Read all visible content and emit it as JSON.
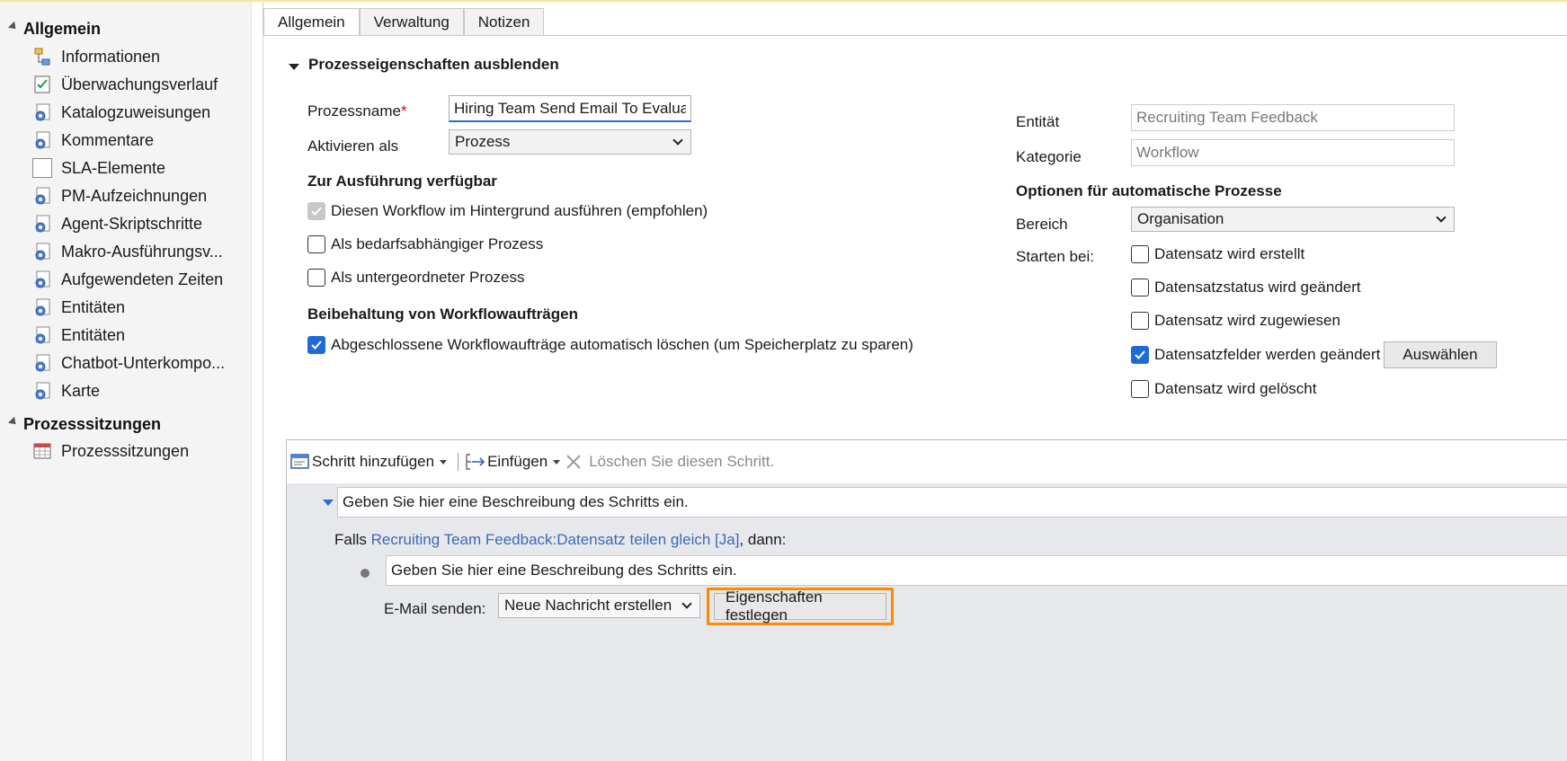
{
  "sidebar": {
    "section1": "Allgemein",
    "items": [
      {
        "label": "Informationen",
        "icon": "hierarchy-icon"
      },
      {
        "label": "Überwachungsverlauf",
        "icon": "checklist-icon"
      },
      {
        "label": "Katalogzuweisungen",
        "icon": "gear-doc-icon"
      },
      {
        "label": "Kommentare",
        "icon": "gear-doc-icon"
      },
      {
        "label": "SLA-Elemente",
        "icon": "blank-box-icon"
      },
      {
        "label": "PM-Aufzeichnungen",
        "icon": "gear-doc-icon"
      },
      {
        "label": "Agent-Skriptschritte",
        "icon": "gear-doc-icon"
      },
      {
        "label": "Makro-Ausführungsv...",
        "icon": "gear-doc-icon"
      },
      {
        "label": "Aufgewendeten Zeiten",
        "icon": "gear-doc-icon"
      },
      {
        "label": "Entitäten",
        "icon": "gear-doc-icon"
      },
      {
        "label": "Entitäten",
        "icon": "gear-doc-icon"
      },
      {
        "label": "Chatbot-Unterkompo...",
        "icon": "gear-doc-icon"
      },
      {
        "label": "Karte",
        "icon": "gear-doc-icon"
      }
    ],
    "section2": "Prozesssitzungen",
    "items2": [
      {
        "label": "Prozesssitzungen",
        "icon": "calendar-grid-icon"
      }
    ]
  },
  "tabs": [
    "Allgemein",
    "Verwaltung",
    "Notizen"
  ],
  "props": {
    "collapse_label": "Prozesseigenschaften ausblenden",
    "name_label": "Prozessname",
    "required_mark": "*",
    "name_value": "Hiring Team Send Email To Evaluate App",
    "activate_label": "Aktivieren als",
    "activate_value": "Prozess",
    "available_head": "Zur Ausführung verfügbar",
    "cb_background": "Diesen Workflow im Hintergrund ausführen (empfohlen)",
    "cb_ondemand": "Als bedarfsabhängiger Prozess",
    "cb_child": "Als untergeordneter Prozess",
    "retention_head": "Beibehaltung von Workflowaufträgen",
    "cb_delete": "Abgeschlossene Workflowaufträge automatisch löschen (um Speicherplatz zu sparen)",
    "entity_label": "Entität",
    "entity_value": "Recruiting Team Feedback",
    "category_label": "Kategorie",
    "category_value": "Workflow",
    "auto_head": "Optionen für automatische Prozesse",
    "scope_label": "Bereich",
    "scope_value": "Organisation",
    "start_label": "Starten bei:",
    "start_created": "Datensatz wird erstellt",
    "start_status": "Datensatzstatus wird geändert",
    "start_assigned": "Datensatz wird zugewiesen",
    "start_fields": "Datensatzfelder werden geändert",
    "select_btn": "Auswählen",
    "start_deleted": "Datensatz wird gelöscht"
  },
  "toolbar": {
    "add_step": "Schritt hinzufügen",
    "insert": "Einfügen",
    "delete": "Löschen Sie diesen Schritt."
  },
  "steps": {
    "desc1": "Geben Sie hier eine Beschreibung des Schritts ein.",
    "cond_prefix": "Falls ",
    "cond_link": "Recruiting Team Feedback:Datensatz teilen gleich [Ja]",
    "cond_suffix": ", dann:",
    "desc2": "Geben Sie hier eine Beschreibung des Schritts ein.",
    "email_label": "E-Mail senden:",
    "email_option": "Neue Nachricht erstellen",
    "set_props_btn": "Eigenschaften festlegen"
  },
  "colors": {
    "accent": "#1e6bd6",
    "link": "#3a6bb5",
    "highlight": "#ff8a00",
    "editor_bg": "#e6e8ec"
  }
}
